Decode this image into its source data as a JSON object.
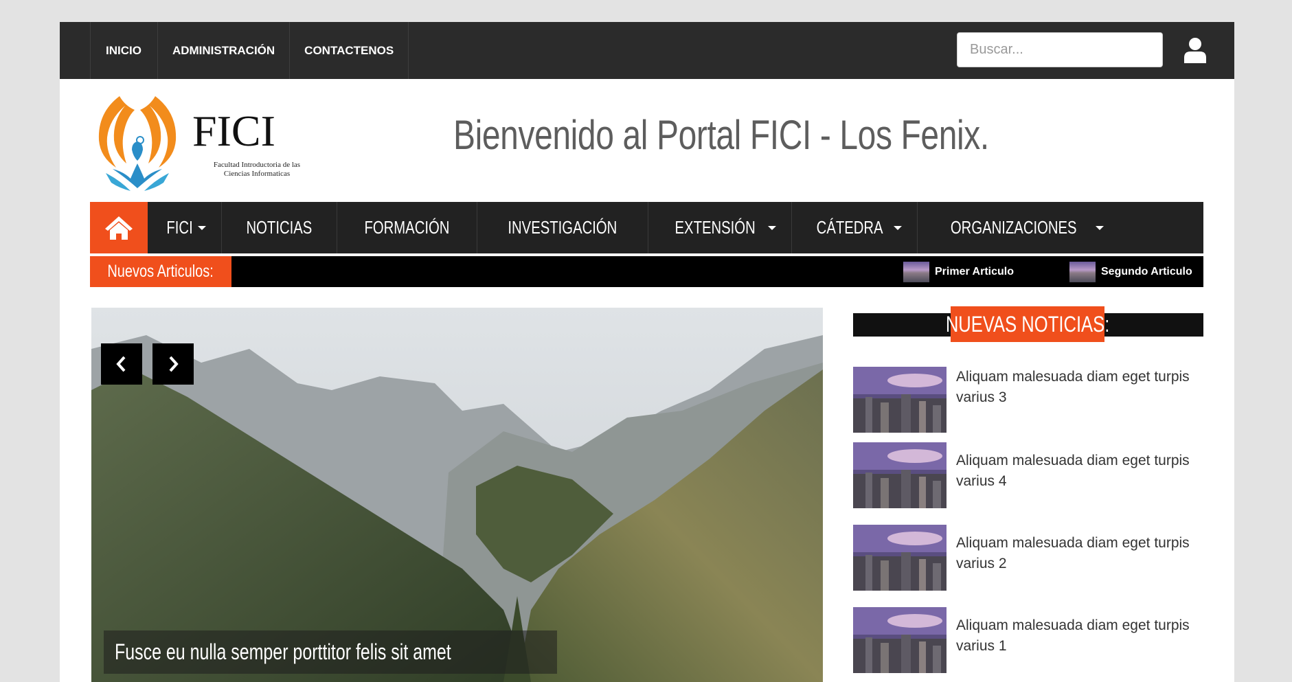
{
  "topbar": {
    "links": [
      "INICIO",
      "ADMINISTRACIÓN",
      "CONTACTENOS"
    ],
    "search_placeholder": "Buscar..."
  },
  "header": {
    "logo_title": "FICI",
    "logo_subtitle_1": "Facultad Introductoria de las",
    "logo_subtitle_2": "Ciencias Informaticas",
    "welcome": "Bienvenido al Portal FICI - Los Fenix."
  },
  "mainnav": {
    "items": [
      {
        "label": "FICI"
      },
      {
        "label": "NOTICIAS"
      },
      {
        "label": "FORMACIÓN"
      },
      {
        "label": "INVESTIGACIÓN"
      },
      {
        "label": "EXTENSIÓN"
      },
      {
        "label": "CÁTEDRA"
      },
      {
        "label": "ORGANIZACIONES"
      }
    ]
  },
  "ticker": {
    "label": "Nuevos Articulos:",
    "items": [
      "Primer Articulo",
      "Segundo Articulo"
    ]
  },
  "slider": {
    "caption": "Fusce eu nulla semper porttitor felis sit amet"
  },
  "sidebar": {
    "title": "NUEVAS NOTICIAS:",
    "news": [
      "Aliquam malesuada diam eget turpis varius 3",
      "Aliquam malesuada diam eget turpis varius 4",
      "Aliquam malesuada diam eget turpis varius 2",
      "Aliquam malesuada diam eget turpis varius 1"
    ]
  },
  "colors": {
    "accent": "#f04f1c",
    "topbar": "#2b2b2b",
    "nav": "#222222"
  }
}
